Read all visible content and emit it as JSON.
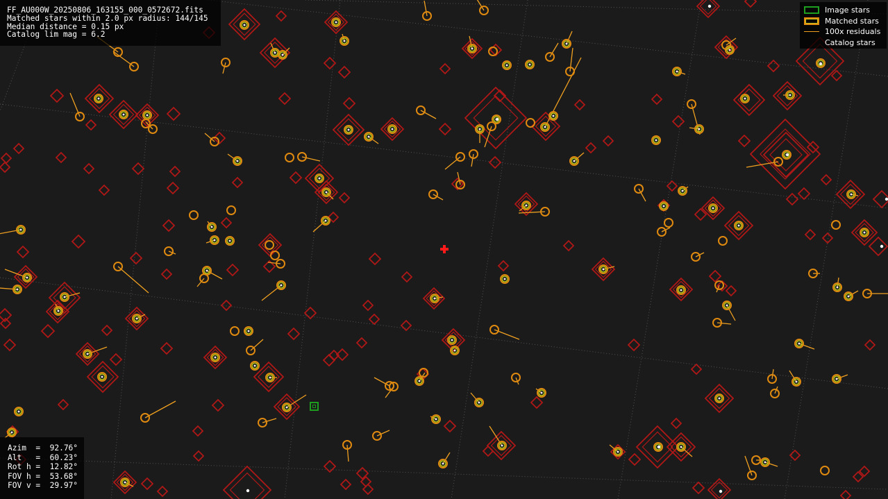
{
  "info": {
    "filename": "FF_AU000W_20250806_163155_000_0572672.fits",
    "matched": "Matched stars within 2.0 px radius: 144/145",
    "median": "Median distance = 0.15 px",
    "catalog": "Catalog lim mag = 6.2"
  },
  "legend": {
    "image_stars": "Image stars",
    "matched_stars": "Matched stars",
    "residuals": "100x residuals",
    "catalog_stars": "Catalog stars"
  },
  "pointing": {
    "azim": "Azim  =  92.76°",
    "alt": "Alt   =  60.23°",
    "roth": "Rot h =  12.82°",
    "fovh": "FOV h =  53.68°",
    "fovv": "FOV v =  29.97°"
  },
  "colors": {
    "background": "#1b1b1b",
    "catalog": "#b01818",
    "matched": "#e08a10",
    "image": "#1e9e1e",
    "residual": "#f0a020",
    "center_marker": "#ff1a1a",
    "grid": "#777777"
  }
}
